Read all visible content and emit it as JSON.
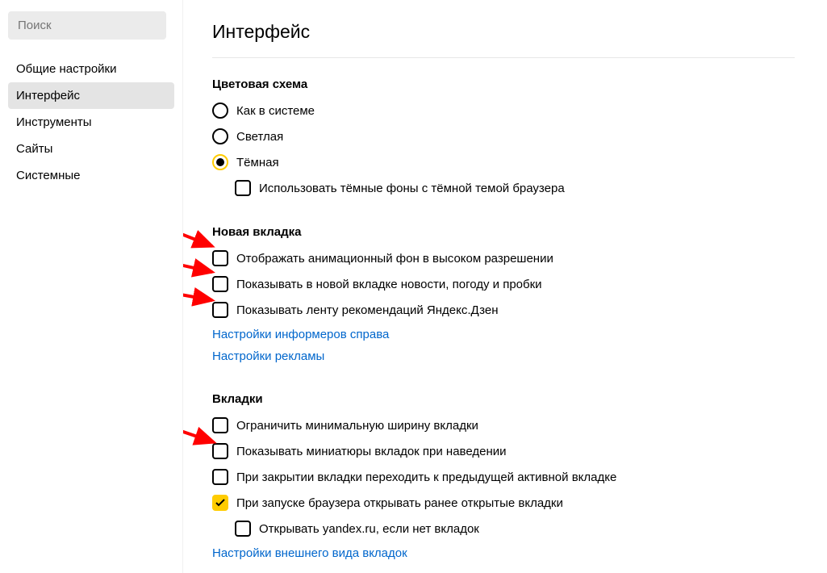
{
  "search": {
    "placeholder": "Поиск"
  },
  "sidebar": {
    "items": [
      {
        "label": "Общие настройки"
      },
      {
        "label": "Интерфейс"
      },
      {
        "label": "Инструменты"
      },
      {
        "label": "Сайты"
      },
      {
        "label": "Системные"
      }
    ]
  },
  "page": {
    "title": "Интерфейс"
  },
  "color_scheme": {
    "title": "Цветовая схема",
    "options": [
      {
        "label": "Как в системе"
      },
      {
        "label": "Светлая"
      },
      {
        "label": "Тёмная"
      }
    ],
    "dark_bg_option": "Использовать тёмные фоны с тёмной темой браузера"
  },
  "new_tab": {
    "title": "Новая вкладка",
    "options": [
      {
        "label": "Отображать анимационный фон в высоком разрешении"
      },
      {
        "label": "Показывать в новой вкладке новости, погоду и пробки"
      },
      {
        "label": "Показывать ленту рекомендаций Яндекс.Дзен"
      }
    ],
    "links": [
      "Настройки информеров справа",
      "Настройки рекламы"
    ]
  },
  "tabs": {
    "title": "Вкладки",
    "options": [
      {
        "label": "Ограничить минимальную ширину вкладки"
      },
      {
        "label": "Показывать миниатюры вкладок при наведении"
      },
      {
        "label": "При закрытии вкладки переходить к предыдущей активной вкладке"
      },
      {
        "label": "При запуске браузера открывать ранее открытые вкладки"
      },
      {
        "label": "Открывать yandex.ru, если нет вкладок"
      }
    ],
    "link": "Настройки внешнего вида вкладок"
  }
}
